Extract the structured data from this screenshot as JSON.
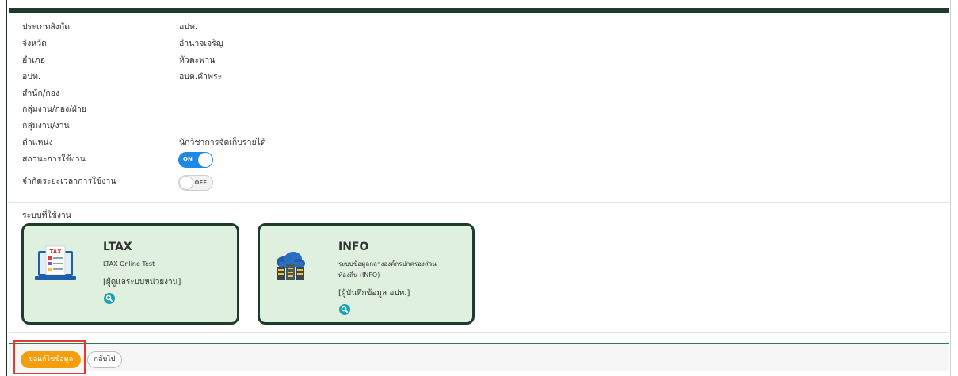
{
  "fields": [
    {
      "label": "ประเภทสังกัด",
      "value": "อปท."
    },
    {
      "label": "จังหวัด",
      "value": "อำนาจเจริญ"
    },
    {
      "label": "อำเภอ",
      "value": "หัวตะพาน"
    },
    {
      "label": "อปท.",
      "value": "อบต.คำพระ"
    },
    {
      "label": "สำนัก/กอง",
      "value": ""
    },
    {
      "label": "กลุ่มงาน/กอง/ฝ่าย",
      "value": ""
    },
    {
      "label": "กลุ่มงาน/งาน",
      "value": ""
    },
    {
      "label": "ตำแหน่ง",
      "value": "นักวิชาการจัดเก็บรายได้"
    }
  ],
  "status": {
    "label": "สถานะการใช้งาน",
    "toggle_text": "ON",
    "state": "on"
  },
  "time_limit": {
    "label": "จำกัดระยะเวลาการใช้งาน",
    "toggle_text": "OFF",
    "state": "off"
  },
  "systems": {
    "title": "ระบบที่ใช้งาน",
    "cards": [
      {
        "icon": "tax-document-icon",
        "icon_text": "TAX",
        "title": "LTAX",
        "desc_line1": "LTAX Online Test",
        "desc_line2": "",
        "role": "[ผู้ดูแลระบบหน่วยงาน]"
      },
      {
        "icon": "cloud-server-icon",
        "title": "INFO",
        "desc_line1": "ระบบข้อมูลกลางองค์กรปกครองส่วน",
        "desc_line2": "ท้องถิ่น (INFO)",
        "role": "[ผู้บันทึกข้อมูล อปท.]"
      }
    ]
  },
  "footer": {
    "request_button": "ขอแก้ไขข้อมูล",
    "back_button": "กลับไป"
  },
  "colors": {
    "accent_green": "#1f3b2c",
    "toggle_on": "#1e88e5",
    "card_bg": "#dff0df",
    "request_button": "#f59e0b",
    "highlight": "#e53935",
    "search_icon": "#17a2b8"
  }
}
